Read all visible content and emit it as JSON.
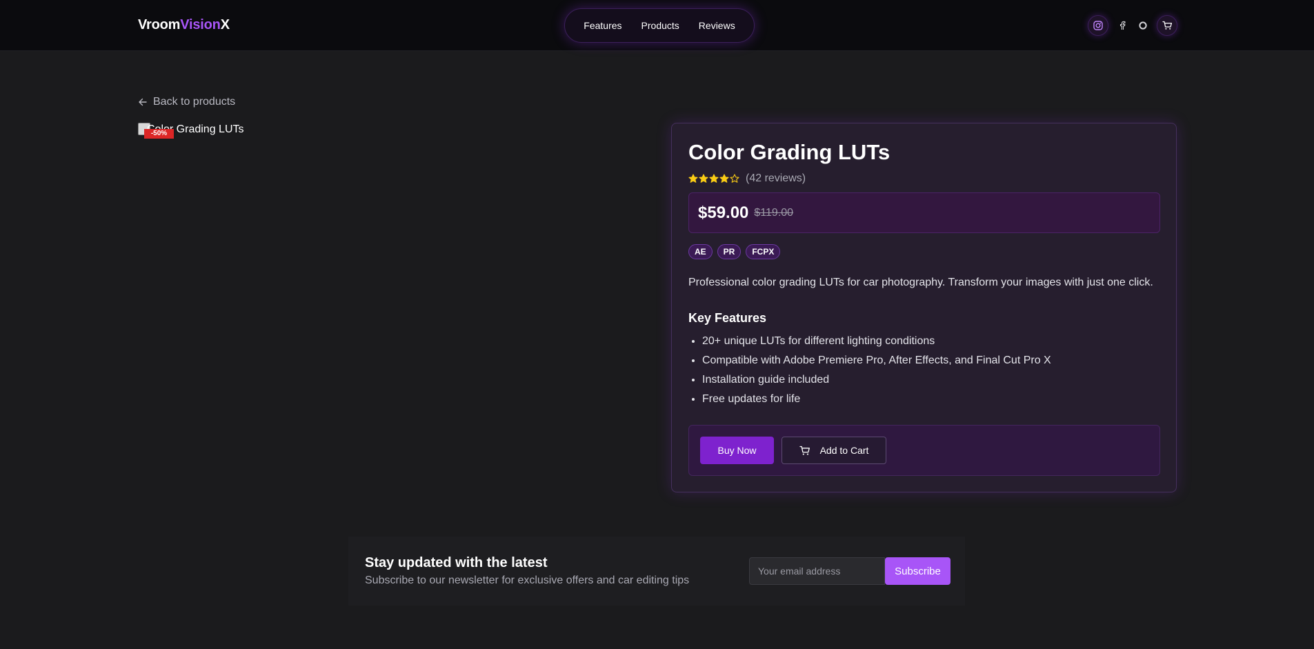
{
  "header": {
    "logo": {
      "part1": "Vroom",
      "part2": "Vision",
      "part3": "X"
    },
    "nav": [
      "Features",
      "Products",
      "Reviews"
    ],
    "icons": [
      "instagram-icon",
      "facebook-icon",
      "circle-icon",
      "cart-icon"
    ]
  },
  "page": {
    "back_label": "Back to products"
  },
  "product": {
    "image_alt": "Color Grading LUTs",
    "discount_badge": "-50%",
    "title": "Color Grading LUTs",
    "rating": 4,
    "rating_max": 5,
    "reviews_label": "(42 reviews)",
    "price_now": "$59.00",
    "price_old": "$119.00",
    "tags": [
      "AE",
      "PR",
      "FCPX"
    ],
    "description": "Professional color grading LUTs for car photography. Transform your images with just one click.",
    "features_title": "Key Features",
    "features": [
      "20+ unique LUTs for different lighting conditions",
      "Compatible with Adobe Premiere Pro, After Effects, and Final Cut Pro X",
      "Installation guide included",
      "Free updates for life"
    ],
    "buy_label": "Buy Now",
    "cart_label": "Add to Cart"
  },
  "newsletter": {
    "title": "Stay updated with the latest",
    "subtitle": "Subscribe to our newsletter for exclusive offers and car editing tips",
    "placeholder": "Your email address",
    "button": "Subscribe"
  },
  "colors": {
    "accent": "#a855f7",
    "buy_button": "#7e22ce",
    "star": "#facc15",
    "badge": "#dc2626"
  }
}
